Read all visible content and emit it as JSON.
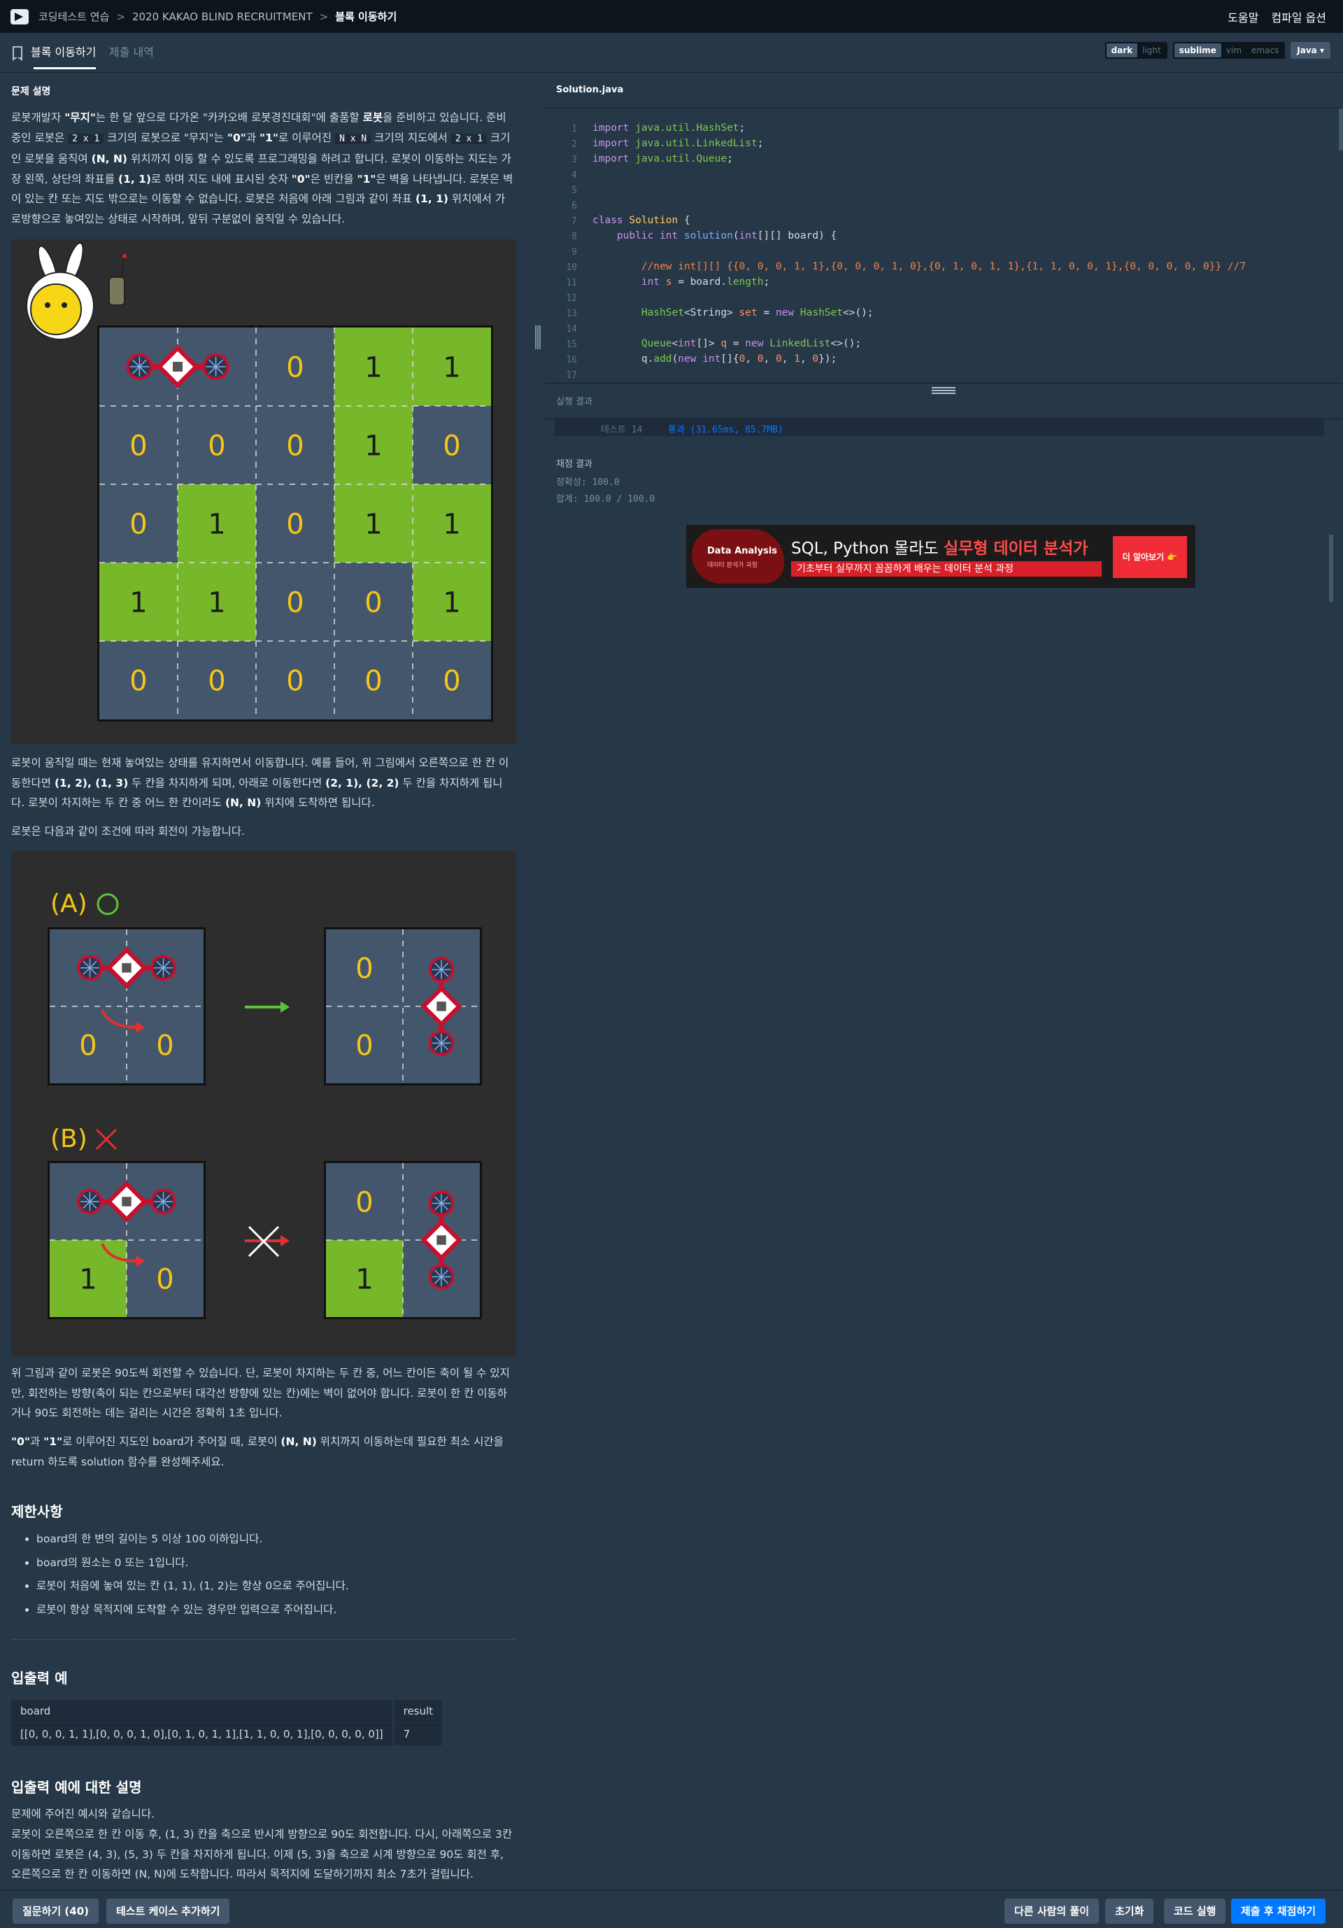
{
  "breadcrumb": {
    "items": [
      "코딩테스트 연습",
      "2020 KAKAO BLIND RECRUITMENT",
      "블록 이동하기"
    ],
    "separator": ">"
  },
  "top_right": {
    "help": "도움말",
    "compile_options": "컴파일 옵션"
  },
  "tabs": {
    "problem": "블록 이동하기",
    "submissions": "제출 내역"
  },
  "toggles": {
    "theme": [
      "dark",
      "light"
    ],
    "keymap": [
      "sublime",
      "vim",
      "emacs"
    ],
    "language": "Java"
  },
  "problem": {
    "section_title": "문제 설명",
    "intro": {
      "p1_a": "로봇개발자 ",
      "muzi": "\"무지\"",
      "p1_b": "는 한 달 앞으로 다가온 \"카카오배 로봇경진대회\"에 출품할 ",
      "robot": "로봇",
      "p1_c": "을 준비하고 있습니다. 준비 중인 로봇은 ",
      "size": "2 x 1",
      "p1_d": " 크기의 로봇으로 \"무지\"는 ",
      "zero": "\"0\"",
      "p1_e": "과 ",
      "one": "\"1\"",
      "p1_f": "로 이루어진 ",
      "nxn": "N x N",
      "p1_g": " 크기의 지도에서 ",
      "size2": "2 x 1",
      "p1_h": " 크기인 로봇을 움직여 ",
      "nn": "(N, N)",
      "p1_i": " 위치까지 이동 할 수 있도록 프로그래밍을 하려고 합니다. 로봇이 이동하는 지도는 가장 왼쪽, 상단의 좌표를 ",
      "oneone": "(1, 1)",
      "p1_j": "로 하며 지도 내에 표시된 숫자 ",
      "zero2": "\"0\"",
      "p1_k": "은 빈칸을 ",
      "one2": "\"1\"",
      "p1_l": "은 벽을 나타냅니다. 로봇은 벽이 있는 칸 또는 지도 밖으로는 이동할 수 없습니다. 로봇은 처음에 아래 그림과 같이 좌표 ",
      "oneone2": "(1, 1)",
      "p1_m": " 위치에서 가로방향으로 놓여있는 상태로 시작하며, 앞뒤 구분없이 움직일 수 있습니다."
    },
    "figure1_grid": [
      [
        "",
        "",
        "0",
        "1",
        "1"
      ],
      [
        "0",
        "0",
        "0",
        "1",
        "0"
      ],
      [
        "0",
        "1",
        "0",
        "1",
        "1"
      ],
      [
        "1",
        "1",
        "0",
        "0",
        "1"
      ],
      [
        "0",
        "0",
        "0",
        "0",
        "0"
      ]
    ],
    "move_para": {
      "a": "로봇이 움직일 때는 현재 놓여있는 상태를 유지하면서 이동합니다. 예를 들어, 위 그림에서 오른쪽으로 한 칸 이동한다면 ",
      "c12": "(1, 2), (1, 3)",
      "b": " 두 칸을 차지하게 되며, 아래로 이동한다면 ",
      "c21": "(2, 1), (2, 2)",
      "c": " 두 칸을 차지하게 됩니다. 로봇이 차지하는 두 칸 중 어느 한 칸이라도 ",
      "nn": "(N, N)",
      "d": " 위치에 도착하면 됩니다."
    },
    "rotate_intro": "로봇은 다음과 같이 조건에 따라 회전이 가능합니다.",
    "figure2": {
      "label_a": "(A)",
      "label_b": "(B)",
      "a_before": [
        "0",
        "0"
      ],
      "a_after": [
        "0",
        "0"
      ],
      "b_before": [
        "1",
        "0"
      ],
      "b_after": [
        "0",
        "1"
      ]
    },
    "rotate_para": "위 그림과 같이 로봇은 90도씩 회전할 수 있습니다. 단, 로봇이 차지하는 두 칸 중, 어느 칸이든 축이 될 수 있지만, 회전하는 방향(축이 되는 칸으로부터 대각선 방향에 있는 칸)에는 벽이 없어야 합니다. 로봇이 한 칸 이동하거나 90도 회전하는 데는 걸리는 시간은 정확히 1초 입니다.",
    "task_para": {
      "q0": "\"0\"",
      "mid": "과 ",
      "q1": "\"1\"",
      "a": "로 이루어진 지도인 board가 주어질 때, 로봇이 ",
      "nn": "(N, N)",
      "b": " 위치까지 이동하는데 필요한 최소 시간을 return 하도록 solution 함수를 완성해주세요."
    },
    "constraints_title": "제한사항",
    "constraints": [
      "board의 한 변의 길이는 5 이상 100 이하입니다.",
      "board의 원소는 0 또는 1입니다.",
      "로봇이 처음에 놓여 있는 칸 (1, 1), (1, 2)는 항상 0으로 주어집니다.",
      "로봇이 항상 목적지에 도착할 수 있는 경우만 입력으로 주어집니다."
    ],
    "io_title": "입출력 예",
    "io_table": {
      "headers": [
        "board",
        "result"
      ],
      "rows": [
        [
          "[[0, 0, 0, 1, 1],[0, 0, 0, 1, 0],[0, 1, 0, 1, 1],[1, 1, 0, 0, 1],[0, 0, 0, 0, 0]]",
          "7"
        ]
      ]
    },
    "explain_title": "입출력 예에 대한 설명",
    "explain_lines": [
      "문제에 주어진 예시와 같습니다.",
      "로봇이 오른쪽으로 한 칸 이동 후, (1, 3) 칸을 축으로 반시계 방향으로 90도 회전합니다. 다시, 아래쪽으로 3칸 이동하면 로봇은 (4, 3), (5, 3) 두 칸을 차지하게 됩니다. 이제 (5, 3)을 축으로 시계 방향으로 90도 회전 후, 오른쪽으로 한 칸 이동하면 (N, N)에 도착합니다. 따라서 목적지에 도달하기까지 최소 7초가 걸립니다."
    ]
  },
  "editor": {
    "filename": "Solution.java",
    "line_numbers": [
      "1",
      "2",
      "3",
      "4",
      "5",
      "6",
      "7",
      "8",
      "9",
      "10",
      "11",
      "12",
      "13",
      "14",
      "15",
      "16",
      "17"
    ]
  },
  "result": {
    "title": "실행 결과",
    "test_label": "테스트 14",
    "test_result": "통과 (31.65ms, 85.7MB)",
    "grading_title": "채점 결과",
    "accuracy": "정확성: 100.0",
    "total": "합계: 100.0 / 100.0"
  },
  "ad": {
    "logo": "Data Analysis",
    "logo_sub": "데이터 분석가 과정",
    "headline_a": "SQL, Python 몰라도 ",
    "headline_b": "실무형 데이터 분석가",
    "subline": "기초부터 실무까지 꼼꼼하게 배우는 데이터 분석 과정",
    "cta": "더 알아보기 👉"
  },
  "bottom": {
    "ask": "질문하기 (40)",
    "add_testcase": "테스트 케이스 추가하기",
    "others": "다른 사람의 풀이",
    "reset": "초기화",
    "run": "코드 실행",
    "submit": "제출 후 채점하기"
  },
  "colors": {
    "background": "#263747",
    "topbar": "#0c151c",
    "wall": "#76b82a",
    "cell": "#44566c",
    "digit": "#f5c518",
    "primary_button": "#0078ff"
  }
}
